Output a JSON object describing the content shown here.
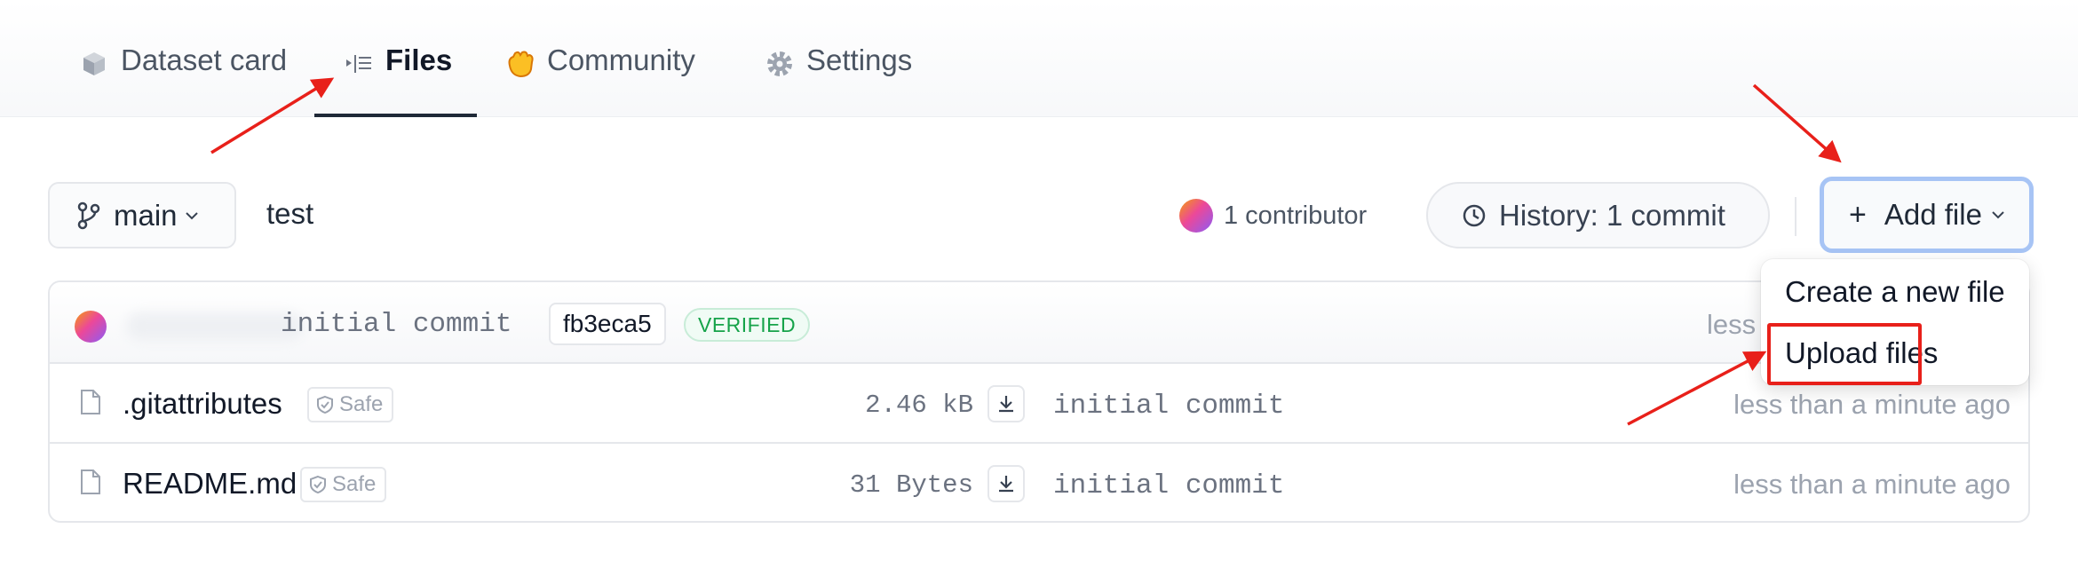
{
  "tabs": [
    {
      "label": "Dataset card",
      "icon": "cube-icon",
      "active": false
    },
    {
      "label": "Files",
      "icon": "files-icon",
      "active": true
    },
    {
      "label": "Community",
      "icon": "hand-icon",
      "active": false
    },
    {
      "label": "Settings",
      "icon": "gear-icon",
      "active": false
    }
  ],
  "toolbar": {
    "branch_label": "main",
    "path": "test",
    "contributors": "1 contributor",
    "history_label": "History: 1 commit",
    "add_file_label": "Add file",
    "add_file_plus": "+"
  },
  "commit": {
    "message": "initial commit",
    "hash": "fb3eca5",
    "verified": "VERIFIED",
    "time": "less"
  },
  "files": [
    {
      "name": ".gitattributes",
      "badge": "Safe",
      "size": "2.46 kB",
      "commit": "initial commit",
      "time": "less than a minute ago"
    },
    {
      "name": "README.md",
      "badge": "Safe",
      "size": "31 Bytes",
      "commit": "initial commit",
      "time": "less than a minute ago"
    }
  ],
  "dropdown": {
    "items": [
      "Create a new file",
      "Upload files"
    ]
  },
  "colors": {
    "annotation": "#e8201a",
    "focus_ring": "#a7c4f5",
    "verified": "#16a34a"
  }
}
